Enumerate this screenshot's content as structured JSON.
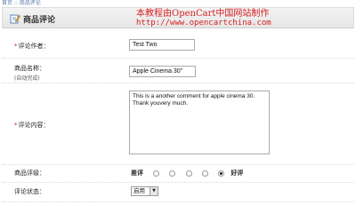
{
  "breadcrumb": [
    "首页",
    "商品评论"
  ],
  "header": {
    "title": "商品评论",
    "icon": "edit-note-icon",
    "watermark_line1": "本教程由OpenCart中国网站制作",
    "watermark_line2": "http://www.opencartchina.com"
  },
  "form": {
    "author": {
      "label": "评论作者：",
      "required": "*",
      "value": "Test Two"
    },
    "product": {
      "label": "商品名称：",
      "hint": "(自动完成)",
      "value": "Apple Cinema 30\""
    },
    "text": {
      "label": "评论内容：",
      "required": "*",
      "value": "This is a another comment for apple cinema 30. Thank youvery much."
    },
    "rating": {
      "label": "商品评级：",
      "bad_label": "差评",
      "good_label": "好评",
      "options": 5,
      "selected": 5
    },
    "status": {
      "label": "评论状态：",
      "value": "启用",
      "arrow": "▼"
    }
  },
  "colors": {
    "watermark": "#d62020",
    "required": "#e02020",
    "link": "#5a7aa6"
  }
}
